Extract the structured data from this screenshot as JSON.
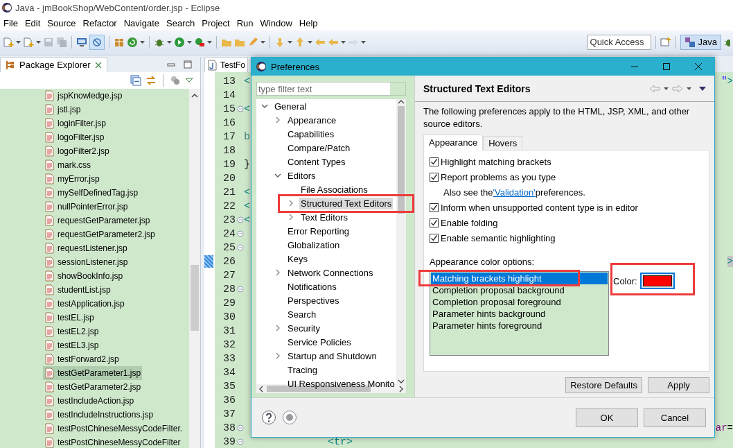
{
  "window": {
    "title": "Java - jmBookShop/WebContent/order.jsp - Eclipse"
  },
  "menu": [
    "File",
    "Edit",
    "Source",
    "Refactor",
    "Navigate",
    "Search",
    "Project",
    "Run",
    "Window",
    "Help"
  ],
  "toolbar": {
    "quick_access": {
      "placeholder": "Quick Access"
    },
    "perspectives": [
      {
        "label": "Java",
        "selected": true
      }
    ]
  },
  "package_explorer": {
    "title": "Package Explorer",
    "files": [
      {
        "name": "jspKnowledge.jsp",
        "selected": false
      },
      {
        "name": "jstl.jsp",
        "selected": false
      },
      {
        "name": "loginFilter.jsp",
        "selected": false
      },
      {
        "name": "logoFilter.jsp",
        "selected": false
      },
      {
        "name": "logoFilter2.jsp",
        "selected": false
      },
      {
        "name": "mark.css",
        "selected": false
      },
      {
        "name": "myError.jsp",
        "selected": false
      },
      {
        "name": "mySelfDefinedTag.jsp",
        "selected": false
      },
      {
        "name": "nullPointerError.jsp",
        "selected": false
      },
      {
        "name": "requestGetParameter.jsp",
        "selected": false
      },
      {
        "name": "requestGetParameter2.jsp",
        "selected": false
      },
      {
        "name": "requestListener.jsp",
        "selected": false
      },
      {
        "name": "sessionListener.jsp",
        "selected": false
      },
      {
        "name": "showBookInfo.jsp",
        "selected": false
      },
      {
        "name": "studentList.jsp",
        "selected": false
      },
      {
        "name": "testApplication.jsp",
        "selected": false
      },
      {
        "name": "testEL.jsp",
        "selected": false
      },
      {
        "name": "testEL2.jsp",
        "selected": false
      },
      {
        "name": "testEL3.jsp",
        "selected": false
      },
      {
        "name": "testForward2.jsp",
        "selected": false
      },
      {
        "name": "testGetParameter1.jsp",
        "selected": true
      },
      {
        "name": "testGetParameter2.jsp",
        "selected": false
      },
      {
        "name": "testIncludeAction.jsp",
        "selected": false
      },
      {
        "name": "testIncludeInstructions.jsp",
        "selected": false
      },
      {
        "name": "testPostChineseMessyCodeFilter.",
        "selected": false
      },
      {
        "name": "testPostChineseMessyCodeFilter",
        "selected": false
      }
    ]
  },
  "editor": {
    "tab": "TestFo",
    "lines": [
      {
        "number": "13",
        "foldable": false,
        "current": false,
        "left": [
          {
            "text": "<",
            "kind": "tag"
          }
        ],
        "right": [
          {
            "text": "\"",
            "kind": "string"
          },
          {
            "text": ">",
            "kind": "tag"
          }
        ]
      },
      {
        "number": "14",
        "foldable": false,
        "current": false
      },
      {
        "number": "15",
        "foldable": true,
        "current": false,
        "left": [
          {
            "text": "<",
            "kind": "tag"
          }
        ]
      },
      {
        "number": "16",
        "foldable": false,
        "current": false
      },
      {
        "number": "17",
        "foldable": false,
        "current": false,
        "left": [
          {
            "text": "b",
            "kind": "code"
          }
        ]
      },
      {
        "number": "18",
        "foldable": false,
        "current": false
      },
      {
        "number": "19",
        "foldable": false,
        "current": false,
        "left": [
          {
            "text": "}",
            "kind": "plain"
          }
        ]
      },
      {
        "number": "20",
        "foldable": false,
        "current": false
      },
      {
        "number": "21",
        "foldable": false,
        "current": false,
        "left": [
          {
            "text": "<",
            "kind": "tag"
          }
        ]
      },
      {
        "number": "22",
        "foldable": false,
        "current": false,
        "left": [
          {
            "text": "<",
            "kind": "tag"
          }
        ]
      },
      {
        "number": "23",
        "foldable": true,
        "current": false,
        "left": [
          {
            "text": "<",
            "kind": "tag"
          }
        ]
      },
      {
        "number": "24",
        "foldable": true,
        "current": false
      },
      {
        "number": "25",
        "foldable": true,
        "current": false
      },
      {
        "number": "26",
        "foldable": false,
        "current": true,
        "right": [
          {
            "text": ">",
            "kind": "tag"
          }
        ]
      },
      {
        "number": "27",
        "foldable": false,
        "current": false
      },
      {
        "number": "28",
        "foldable": true,
        "current": false
      },
      {
        "number": "29",
        "foldable": false,
        "current": false
      },
      {
        "number": "30",
        "foldable": false,
        "current": false
      },
      {
        "number": "31",
        "foldable": false,
        "current": false
      },
      {
        "number": "32",
        "foldable": false,
        "current": false
      },
      {
        "number": "33",
        "foldable": false,
        "current": false
      },
      {
        "number": "34",
        "foldable": false,
        "current": false
      },
      {
        "number": "35",
        "foldable": false,
        "current": false
      },
      {
        "number": "36",
        "foldable": false,
        "current": false
      },
      {
        "number": "37",
        "foldable": false,
        "current": false
      },
      {
        "number": "38",
        "foldable": true,
        "current": false,
        "right": [
          {
            "text": "ar",
            "kind": "attr"
          },
          {
            "text": "=",
            "kind": "plain"
          }
        ]
      },
      {
        "number": "39",
        "foldable": true,
        "current": false,
        "middle": [
          {
            "text": "<tr>",
            "kind": "tag"
          }
        ]
      }
    ]
  },
  "preferences": {
    "title": "Preferences",
    "filter": {
      "placeholder": "type filter text"
    },
    "tree": [
      {
        "label": "General",
        "selected": false,
        "marked": false,
        "expanded": true,
        "children": [
          {
            "label": "Appearance",
            "selected": false,
            "marked": false,
            "expanded": false
          },
          {
            "label": "Capabilities",
            "selected": false,
            "marked": false
          },
          {
            "label": "Compare/Patch",
            "selected": false,
            "marked": false
          },
          {
            "label": "Content Types",
            "selected": false,
            "marked": false
          },
          {
            "label": "Editors",
            "selected": false,
            "marked": false,
            "expanded": true,
            "children": [
              {
                "label": "File Associations",
                "selected": false,
                "marked": false
              },
              {
                "label": "Structured Text Editors",
                "selected": true,
                "marked": true,
                "expanded": false
              },
              {
                "label": "Text Editors",
                "selected": false,
                "marked": false,
                "expanded": false
              }
            ]
          },
          {
            "label": "Error Reporting",
            "selected": false,
            "marked": false
          },
          {
            "label": "Globalization",
            "selected": false,
            "marked": false
          },
          {
            "label": "Keys",
            "selected": false,
            "marked": false
          },
          {
            "label": "Network Connections",
            "selected": false,
            "marked": false,
            "expanded": false
          },
          {
            "label": "Notifications",
            "selected": false,
            "marked": false
          },
          {
            "label": "Perspectives",
            "selected": false,
            "marked": false
          },
          {
            "label": "Search",
            "selected": false,
            "marked": false
          },
          {
            "label": "Security",
            "selected": false,
            "marked": false,
            "expanded": false
          },
          {
            "label": "Service Policies",
            "selected": false,
            "marked": false
          },
          {
            "label": "Startup and Shutdown",
            "selected": false,
            "marked": false,
            "expanded": false
          },
          {
            "label": "Tracing",
            "selected": false,
            "marked": false
          },
          {
            "label": "UI Responsiveness Monito",
            "selected": false,
            "marked": false
          }
        ]
      }
    ],
    "page": {
      "title": "Structured Text Editors",
      "description": "The following preferences apply to the HTML, JSP, XML, and other source editors.",
      "tabs": [
        {
          "label": "Appearance",
          "selected": true
        },
        {
          "label": "Hovers",
          "selected": false
        }
      ],
      "options": [
        {
          "kind": "checkbox",
          "label": "Highlight matching brackets",
          "checked": true
        },
        {
          "kind": "checkbox",
          "label": "Report problems as you type",
          "checked": true
        },
        {
          "kind": "note",
          "before": "Also see the",
          "link": "'Validation'",
          "after": "preferences."
        },
        {
          "kind": "checkbox",
          "label": "Inform when unsupported content type is in editor",
          "checked": true
        },
        {
          "kind": "checkbox",
          "label": "Enable folding",
          "checked": true
        },
        {
          "kind": "checkbox",
          "label": "Enable semantic highlighting",
          "checked": true
        }
      ],
      "color_options": {
        "label": "Appearance color options:",
        "items": [
          {
            "label": "Matching brackets highlight",
            "selected": true,
            "marked": true
          },
          {
            "label": "Completion proposal background",
            "selected": false,
            "marked": false
          },
          {
            "label": "Completion proposal foreground",
            "selected": false,
            "marked": false
          },
          {
            "label": "Parameter hints background",
            "selected": false,
            "marked": false
          },
          {
            "label": "Parameter hints foreground",
            "selected": false,
            "marked": false
          }
        ]
      },
      "color": {
        "label": "Color:",
        "color": "#ff0000",
        "marked": true
      },
      "buttons": [
        "Restore Defaults",
        "Apply"
      ]
    },
    "buttons": [
      "OK",
      "Cancel"
    ]
  }
}
